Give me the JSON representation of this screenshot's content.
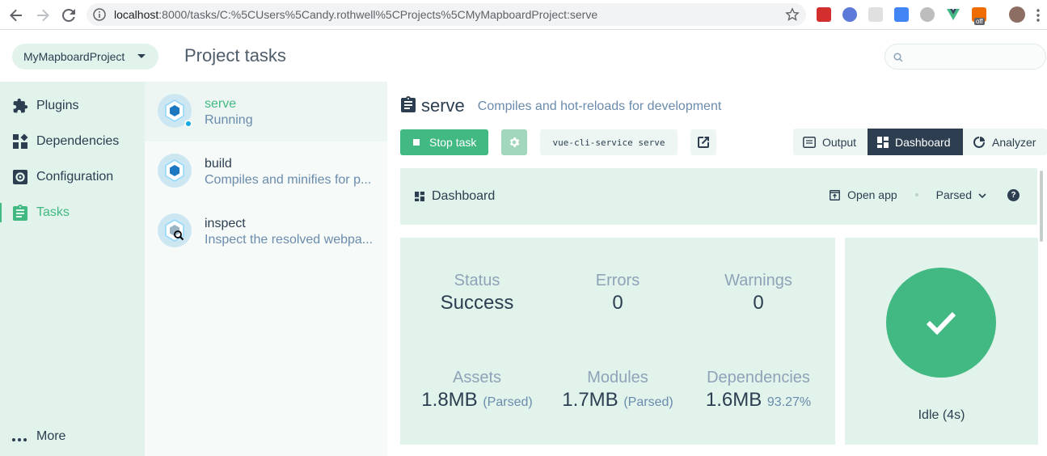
{
  "browser": {
    "url_host": "localhost",
    "url_rest": ":8000/tasks/C:%5CUsers%5Candy.rothwell%5CProjects%5CMyMapboardProject:serve",
    "ext_off_badge": "off"
  },
  "topbar": {
    "project_name": "MyMapboardProject",
    "page_title": "Project tasks",
    "search_placeholder": ""
  },
  "sidebar": {
    "items": [
      {
        "label": "Plugins",
        "icon": "puzzle-icon"
      },
      {
        "label": "Dependencies",
        "icon": "dependencies-icon"
      },
      {
        "label": "Configuration",
        "icon": "settings-icon"
      },
      {
        "label": "Tasks",
        "icon": "clipboard-icon",
        "active": true
      }
    ],
    "more_label": "More"
  },
  "tasks": [
    {
      "name": "serve",
      "description": "Running",
      "selected": true
    },
    {
      "name": "build",
      "description": "Compiles and minifies for p..."
    },
    {
      "name": "inspect",
      "description": "Inspect the resolved webpa..."
    }
  ],
  "task_detail": {
    "name": "serve",
    "description": "Compiles and hot-reloads for development",
    "stop_label": "Stop task",
    "command": "vue-cli-service serve",
    "views": [
      {
        "label": "Output",
        "icon": "terminal-icon"
      },
      {
        "label": "Dashboard",
        "icon": "dashboard-icon",
        "active": true
      },
      {
        "label": "Analyzer",
        "icon": "analyzer-icon"
      }
    ]
  },
  "dashboard": {
    "title": "Dashboard",
    "open_app_label": "Open app",
    "mode_label": "Parsed",
    "help_label": "?",
    "stats": {
      "status_label": "Status",
      "status_value": "Success",
      "errors_label": "Errors",
      "errors_value": "0",
      "warnings_label": "Warnings",
      "warnings_value": "0",
      "assets_label": "Assets",
      "assets_value": "1.8MB",
      "assets_sub": "(Parsed)",
      "modules_label": "Modules",
      "modules_value": "1.7MB",
      "modules_sub": "(Parsed)",
      "deps_label": "Dependencies",
      "deps_value": "1.6MB",
      "deps_pct": "93.27%"
    },
    "build_status": "Idle (4s)"
  },
  "colors": {
    "accent": "#42b983",
    "panel": "#e1f3eb",
    "dark": "#2c3e50",
    "muted": "#6a8bad"
  }
}
